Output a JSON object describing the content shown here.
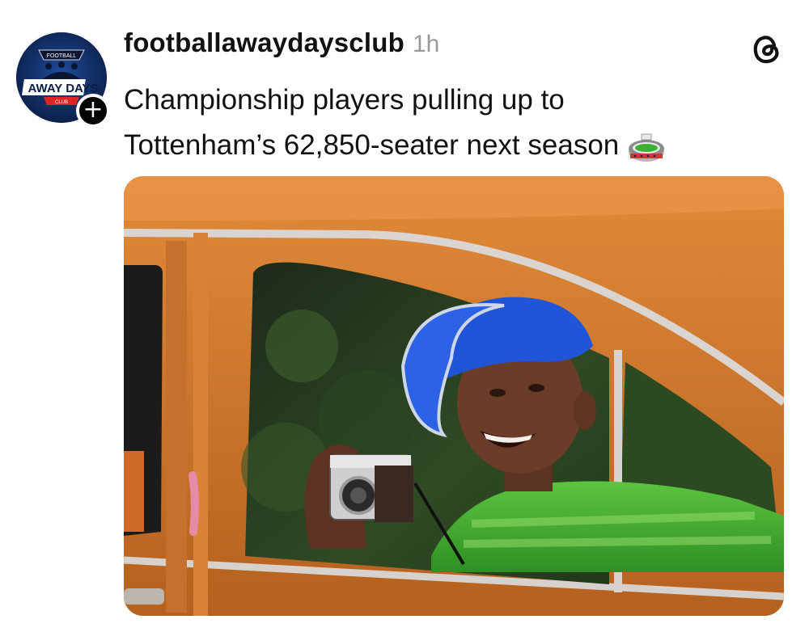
{
  "post": {
    "username": "footballawaydaysclub",
    "time": "1h",
    "caption_line1": "Championship players pulling up to",
    "caption_line2": "Tottenham’s 62,850-seater next season",
    "emoji": "stadium-emoji"
  },
  "avatar": {
    "logo_text_top": "FOOTBALL",
    "logo_text_main": "AWAY DAYS",
    "logo_text_bottom": "CLUB",
    "follow_symbol": "+"
  },
  "icons": {
    "app": "threads-icon",
    "follow": "plus-icon"
  },
  "colors": {
    "background": "#ffffff",
    "text": "#111111",
    "muted": "#9a9a9a",
    "avatar_bg": "#0f2a5a",
    "car_orange": "#c8782e",
    "cap_blue": "#1f55d6",
    "shirt_green": "#3fae32"
  }
}
